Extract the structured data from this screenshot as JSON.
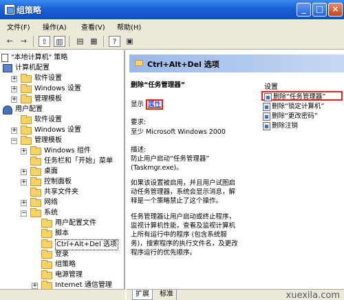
{
  "window": {
    "title": "组策略",
    "buttons": {
      "minimize": "_",
      "maximize": "□",
      "close": "×"
    }
  },
  "menu": [
    "文件(F)",
    "操作(A)",
    "查看(V)",
    "帮助(H)"
  ],
  "toolbar": [
    "back-arrow-icon",
    "forward-arrow-icon",
    "up-folder-icon",
    "show-tree-icon",
    "properties-icon",
    "export-icon",
    "help-icon",
    "view-icon"
  ],
  "tree": {
    "root": "\"本地计算机\" 策略",
    "computer_config": "计算机配置",
    "cc_software": "软件设置",
    "cc_windows": "Windows 设置",
    "cc_admin": "管理模板",
    "user_config": "用户配置",
    "uc_software": "软件设置",
    "uc_windows": "Windows 设置",
    "uc_admin": "管理模板",
    "windows_components": "Windows 组件",
    "taskbar": "任务栏和「开始」菜单",
    "desktop": "桌面",
    "control_panel": "控制面板",
    "shared_folders": "共享文件夹",
    "network": "网络",
    "system": "系统",
    "user_profiles": "用户配置文件",
    "scripts": "脚本",
    "ctrl_alt_del": "Ctrl+Alt+Del 选项",
    "logon": "登录",
    "group_policy": "组策略",
    "power_management": "电源管理",
    "internet_comm": "Internet 通信管理"
  },
  "detail": {
    "header_title": "Ctrl+Alt+Del 选项",
    "policy_title": "删除“任务管理器”",
    "display_label": "显示",
    "properties_link": "属性",
    "requirements_label": "要求:",
    "requirements_value": "至少 Microsoft Windows 2000",
    "description_label": "描述:",
    "description_1": "防止用户启动“任务管理器”",
    "description_2": "(Taskmgr.exe)。",
    "description_3": "如果该设置被启用，并且用户试图启",
    "description_4": "动任务管理器，系统会显示消息，解",
    "description_5": "释是一个策略禁止了这个操作。",
    "description_6": "任务管理器让用户启动或终止程序，",
    "description_7": "监视计算机性能，查看及监视计算机",
    "description_8": "上所有运行中的程序 (包含系统服",
    "description_9": "务)，搜索程序的执行文件名，及更改",
    "description_10": "程序运行的优先顺序。"
  },
  "settings": {
    "header": "设置",
    "items": [
      "删除“任务管理器”",
      "删除“锁定计算机”",
      "删除“更改密码”",
      "删除注销"
    ]
  },
  "tabs": [
    "扩展",
    "标准"
  ],
  "watermark": "xuexila.com",
  "colors": {
    "titlebar": "#1b5fd6",
    "highlight_border": "#e02020",
    "link": "#0000cc"
  }
}
